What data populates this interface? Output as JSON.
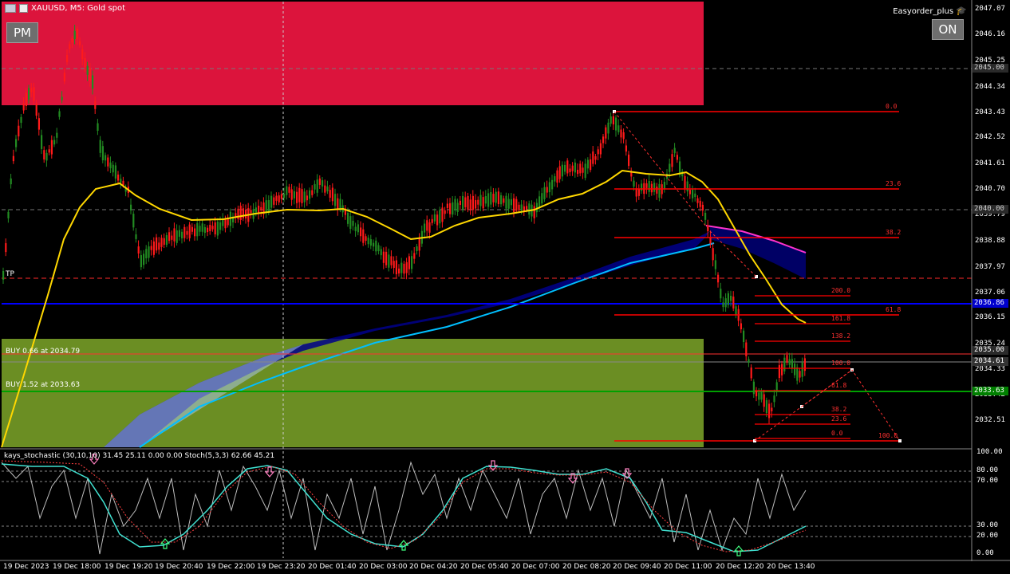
{
  "window": {
    "title": "XAUUSD, M5:  Gold spot",
    "ea_name": "Easyorder_plus",
    "pm_button": "PM",
    "on_button": "ON"
  },
  "colors": {
    "background": "#000000",
    "bull_candle": "#228b22",
    "bear_candle": "#ff1a1a",
    "sell_zone": "#dc143c",
    "buy_zone": "#6b8e23",
    "ma_yellow": "#ffd700",
    "band_blue": "#00008b",
    "band_cyan": "#00bfff",
    "fib_red": "#ff0000"
  },
  "price_axis": {
    "ticks": [
      "2047.07",
      "2046.16",
      "2045.25",
      "2044.34",
      "2043.43",
      "2042.52",
      "2041.61",
      "2040.70",
      "2039.79",
      "2038.88",
      "2037.97",
      "2037.06",
      "2036.15",
      "2035.24",
      "2034.33",
      "2033.42",
      "2032.51"
    ],
    "markers": [
      {
        "label": "2045.00",
        "bg": "#2a2a2a",
        "fg": "#cfcfcf"
      },
      {
        "label": "2040.00",
        "bg": "#2a2a2a",
        "fg": "#cfcfcf"
      },
      {
        "label": "2036.86",
        "bg": "#0000cd",
        "fg": "#ffffff"
      },
      {
        "label": "2035.00",
        "bg": "#2a2a2a",
        "fg": "#ffffff"
      },
      {
        "label": "2034.61",
        "bg": "#333333",
        "fg": "#ffffff"
      },
      {
        "label": "2033.63",
        "bg": "#008000",
        "fg": "#ffffff"
      }
    ]
  },
  "time_axis": [
    "19 Dec 2023",
    "19 Dec 18:00",
    "19 Dec 19:20",
    "19 Dec 20:40",
    "19 Dec 22:00",
    "19 Dec 23:20",
    "20 Dec 01:40",
    "20 Dec 03:00",
    "20 Dec 04:20",
    "20 Dec 05:40",
    "20 Dec 07:00",
    "20 Dec 08:20",
    "20 Dec 09:40",
    "20 Dec 11:00",
    "20 Dec 12:20",
    "20 Dec 13:40"
  ],
  "lines": {
    "tp_label": "TP",
    "buy1_label": "BUY 0.66 at 2034.79",
    "buy2_label": "BUY 1.52 at 2033.63"
  },
  "fib_big": [
    "0.0",
    "23.6",
    "38.2",
    "61.8",
    "100.0"
  ],
  "fib_small": [
    "200.0",
    "161.8",
    "138.2",
    "100.0",
    "61.8",
    "38.2",
    "23.6",
    "0.0"
  ],
  "indicator": {
    "label": "kays_stochastic (30,10,10) 31.45 25.11 0.00 0.00 Stoch(5,3,3) 62.66 45.21",
    "levels": [
      "100.00",
      "80.00",
      "70.00",
      "30.00",
      "20.00",
      "0.00"
    ]
  }
}
